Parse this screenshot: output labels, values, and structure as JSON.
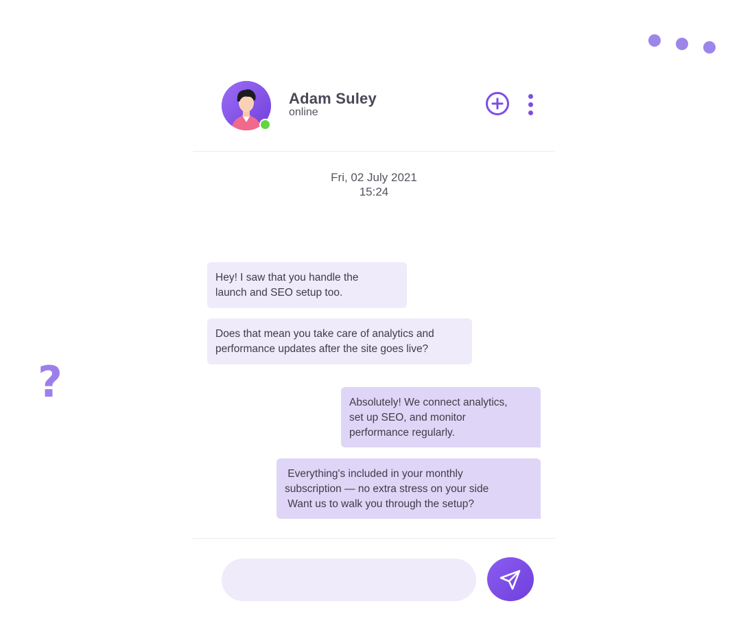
{
  "contact": {
    "name": "Adam Suley",
    "status": "online",
    "avatar_icon": "user-avatar",
    "status_color": "#65d345"
  },
  "header_actions": {
    "add_icon": "plus-circle-icon",
    "menu_icon": "more-vertical-icon"
  },
  "conversation": {
    "date": "Fri, 02 July 2021",
    "time": "15:24"
  },
  "messages": [
    {
      "direction": "incoming",
      "lines": [
        "Hey! I saw that you handle the",
        "launch and SEO setup too."
      ]
    },
    {
      "direction": "incoming",
      "lines": [
        "Does that mean you take care of analytics and",
        "performance updates after the site goes live?"
      ]
    },
    {
      "direction": "outgoing",
      "lines": [
        "Absolutely! We connect analytics,",
        "set up SEO, and monitor",
        "performance regularly."
      ]
    },
    {
      "direction": "outgoing",
      "lines": [
        " Everything's included in your monthly",
        "subscription — no extra stress on your side",
        " Want us to walk you through the setup?"
      ]
    }
  ],
  "composer": {
    "value": "",
    "placeholder": "",
    "send_icon": "send-icon"
  },
  "colors": {
    "accent": "#7b4fe0",
    "incoming_bubble": "#efebfb",
    "outgoing_bubble": "#dfd6f7"
  }
}
